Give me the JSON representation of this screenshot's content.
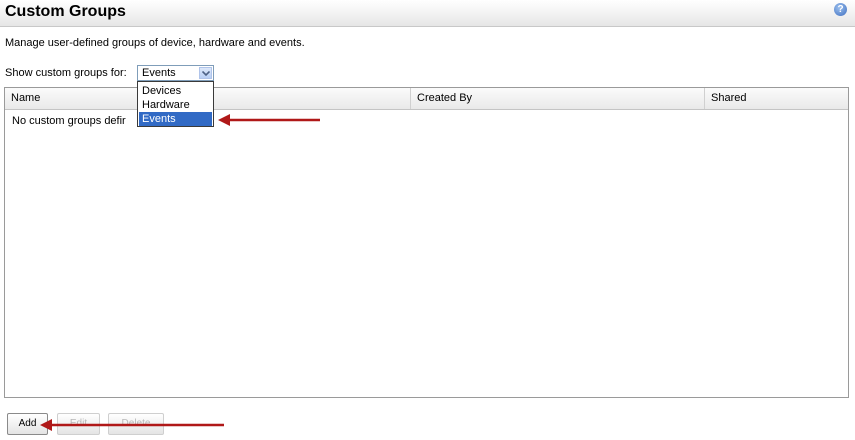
{
  "header": {
    "title": "Custom Groups",
    "help_icon": "?"
  },
  "description": "Manage user-defined groups of device, hardware and events.",
  "filter": {
    "label": "Show custom groups for:",
    "selected": "Events",
    "options": [
      "Devices",
      "Hardware",
      "Events"
    ]
  },
  "table": {
    "columns": [
      "Name",
      "Created By",
      "Shared"
    ],
    "empty_message": "No custom groups defir"
  },
  "buttons": {
    "add": "Add",
    "edit": "Edit",
    "delete": "Delete"
  },
  "colors": {
    "annotation_arrow": "#b01818",
    "selection": "#316ac5"
  }
}
